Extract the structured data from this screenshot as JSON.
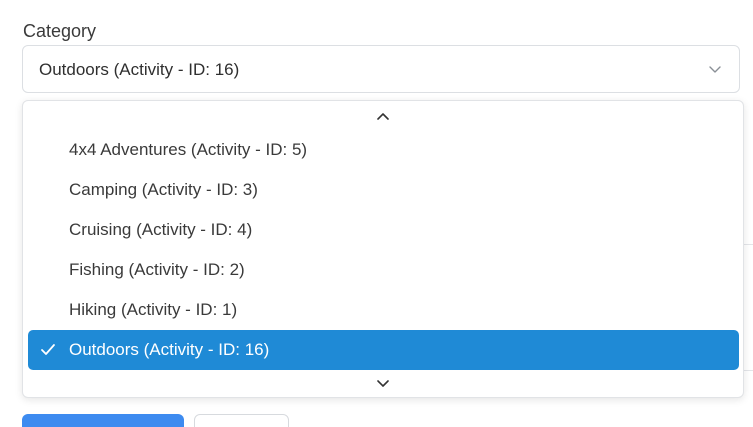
{
  "field": {
    "label": "Category",
    "selected_value": "Outdoors (Activity - ID: 16)",
    "chevron_icon": "chevron-down-icon"
  },
  "dropdown": {
    "scroll_up_icon": "chevron-up-icon",
    "scroll_down_icon": "chevron-down-icon",
    "options": [
      {
        "label": "4x4 Adventures (Activity - ID: 5)",
        "selected": false
      },
      {
        "label": "Camping (Activity - ID: 3)",
        "selected": false
      },
      {
        "label": "Cruising (Activity - ID: 4)",
        "selected": false
      },
      {
        "label": "Fishing (Activity - ID: 2)",
        "selected": false
      },
      {
        "label": "Hiking (Activity - ID: 1)",
        "selected": false
      },
      {
        "label": "Outdoors (Activity - ID: 16)",
        "selected": true
      }
    ],
    "selected_check_icon": "check-icon"
  },
  "colors": {
    "selected_bg": "#1f8ad6",
    "selected_text": "#ffffff",
    "primary_button": "#3d8bf0"
  }
}
